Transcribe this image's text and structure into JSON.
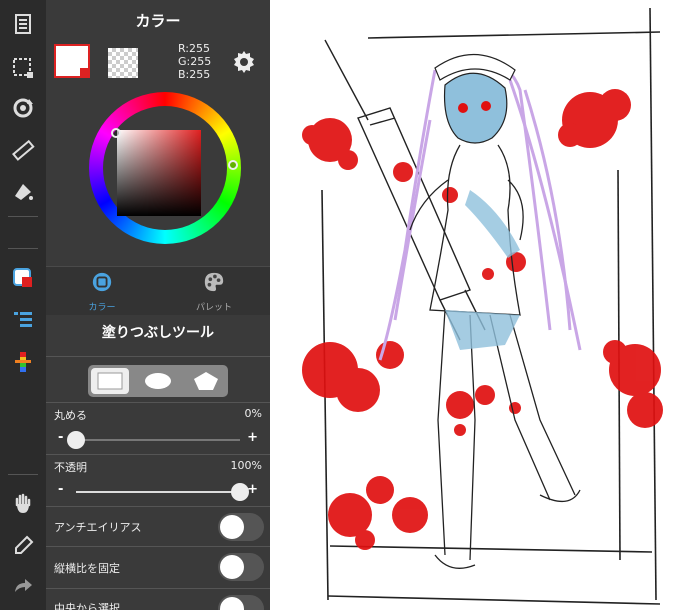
{
  "toolbar": {
    "top_tools": [
      "layers-icon",
      "selection-icon",
      "transform-icon",
      "ruler-icon",
      "fill-tool-icon"
    ],
    "mid_tools": [
      "color-panel-icon",
      "layer-list-icon",
      "brush-palette-icon"
    ],
    "bottom_tools": [
      "hand-icon",
      "eyedropper-icon",
      "redo-icon"
    ]
  },
  "color_panel": {
    "title": "カラー",
    "foreground": "#ffffff",
    "rgb": {
      "r": "R:255",
      "g": "G:255",
      "b": "B:255"
    },
    "tabs": [
      {
        "label": "カラー",
        "icon": "color-tab-icon",
        "active": true
      },
      {
        "label": "パレット",
        "icon": "palette-icon",
        "active": false
      }
    ]
  },
  "tool_panel": {
    "title": "塗りつぶしツール",
    "shapes": [
      "rectangle-shape",
      "ellipse-shape",
      "polygon-shape"
    ],
    "rounding": {
      "label": "丸める",
      "value": "0%",
      "level": 0
    },
    "opacity": {
      "label": "不透明",
      "value": "100%",
      "level": 1.0
    },
    "antialias": {
      "label": "アンチエイリアス",
      "on": false
    },
    "fix_ratio": {
      "label": "縦横比を固定",
      "on": false
    },
    "from_center": {
      "label": "中央から選択",
      "on": false
    },
    "minus": "-",
    "plus": "+"
  },
  "colors": {
    "toolbar_bg": "#2b2b2b",
    "panel_bg": "#3a3a3a",
    "accent": "#4aa3e0",
    "blood": "#e01010",
    "hair": "#c9a6e6",
    "skin": "#8fc0dc"
  }
}
